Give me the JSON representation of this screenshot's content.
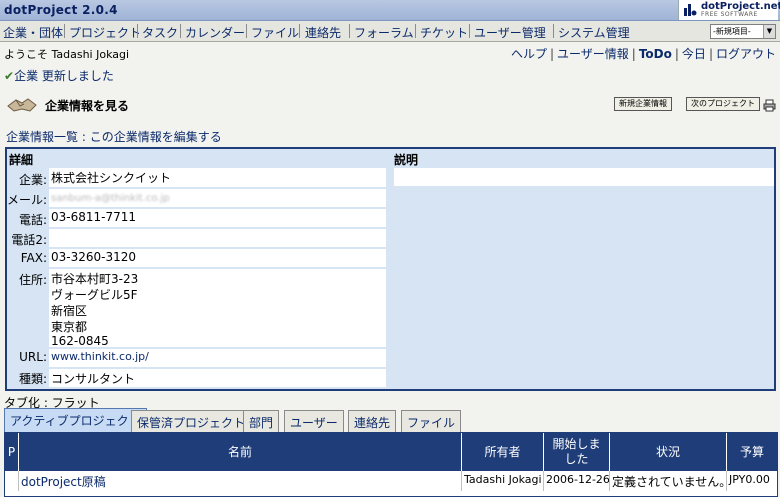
{
  "app": {
    "title": "dotProject 2.0.4",
    "logo_text": "dotProject.net",
    "logo_sub": "FREE SOFTWARE"
  },
  "menu": [
    "企業・団体",
    "プロジェクト",
    "タスク",
    "カレンダー",
    "ファイル",
    "連絡先",
    "フォーラム",
    "チケット",
    "ユーザー管理",
    "システム管理"
  ],
  "new_item_select": {
    "value": "-新規項目-"
  },
  "header": {
    "welcome": "ようこそ Tadashi Jokagi",
    "links": [
      "ヘルプ",
      "ユーザー情報",
      "ToDo",
      "今日",
      "ログアウト"
    ]
  },
  "message": {
    "text": "企業 更新しました"
  },
  "page": {
    "title": "企業情報を見る",
    "btn_new": "新規企業情報",
    "btn_next": "次のプロジェクト"
  },
  "breadcrumb": {
    "list": "企業情報一覧",
    "sep": " : ",
    "edit": "この企業情報を編集する"
  },
  "detail": {
    "section_title": "詳細",
    "desc_title": "説明",
    "labels": {
      "company": "企業:",
      "email": "メール:",
      "phone": "電話:",
      "phone2": "電話2:",
      "fax": "FAX:",
      "address": "住所:",
      "url": "URL:",
      "type": "種類:"
    },
    "values": {
      "company": "株式会社シンクイット",
      "email": "sanbum-a@thinkit.co.jp",
      "phone": "03-6811-7711",
      "phone2": "",
      "fax": "03-3260-3120",
      "address": [
        "市谷本村町3-23",
        "ヴォーグビル5F",
        "新宿区",
        "東京都",
        "162-0845"
      ],
      "url": "www.thinkit.co.jp/",
      "type": "コンサルタント"
    }
  },
  "tabs": {
    "label": "タブ化 : フラット",
    "items": [
      "アクティブプロジェクト",
      "保管済プロジェクト",
      "部門",
      "ユーザー",
      "連絡先",
      "ファイル"
    ]
  },
  "projects": {
    "headers": [
      "P",
      "名前",
      "所有者",
      "開始しました",
      "状況",
      "予算"
    ],
    "rows": [
      {
        "priority": "",
        "name": "dotProject原稿",
        "owner": "Tadashi Jokagi",
        "start": "2006-12-26",
        "status": "定義されていません。",
        "budget": "JPY0.00"
      }
    ]
  },
  "colors": {
    "accent": "#1f3d78",
    "panel": "#d6e4f4",
    "link": "#0b2a6b"
  }
}
